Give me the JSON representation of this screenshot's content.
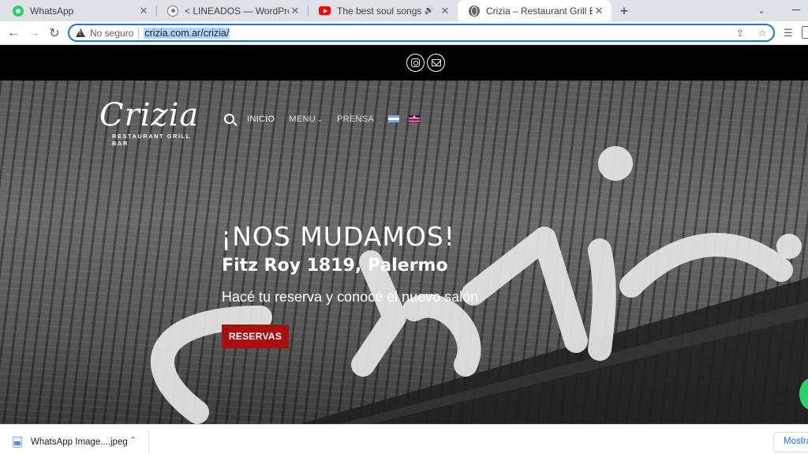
{
  "browser": {
    "tabs": [
      {
        "title": "WhatsApp",
        "favicon": "whatsapp-icon"
      },
      {
        "title": "< LINEADOS — WordPress",
        "favicon": "wordpress-icon"
      },
      {
        "title": "The best soul songs - Top hit",
        "favicon": "youtube-icon",
        "audio": true
      },
      {
        "title": "Crizia – Restaurant Grill Bar",
        "favicon": "globe-icon",
        "active": true
      }
    ],
    "new_tab_label": "+",
    "security_label": "No seguro",
    "url": "crizia.com.ar/crizia/",
    "omnibox_focus_color": "#1a73e8"
  },
  "site": {
    "logo": "Crizia",
    "logo_subtitle": "RESTAURANT GRILL BAR",
    "menu": [
      {
        "label": "INICIO"
      },
      {
        "label": "MENU",
        "has_dropdown": true
      },
      {
        "label": "PRENSA"
      }
    ],
    "languages": [
      "flag-argentina-icon",
      "flag-uk-icon"
    ],
    "hero": {
      "headline": "¡NOS MUDAMOS!",
      "address": "Fitz Roy 1819, Palermo",
      "subtext": "Hacé tu reserva y conocé el nuevo salón",
      "cta_label": "RESERVAS",
      "cta_color": "#a80f0f"
    },
    "social": [
      "instagram-icon",
      "email-icon"
    ]
  },
  "downloads": {
    "file_name": "WhatsApp Image....jpeg",
    "show_all_label": "Mostrar todo"
  }
}
